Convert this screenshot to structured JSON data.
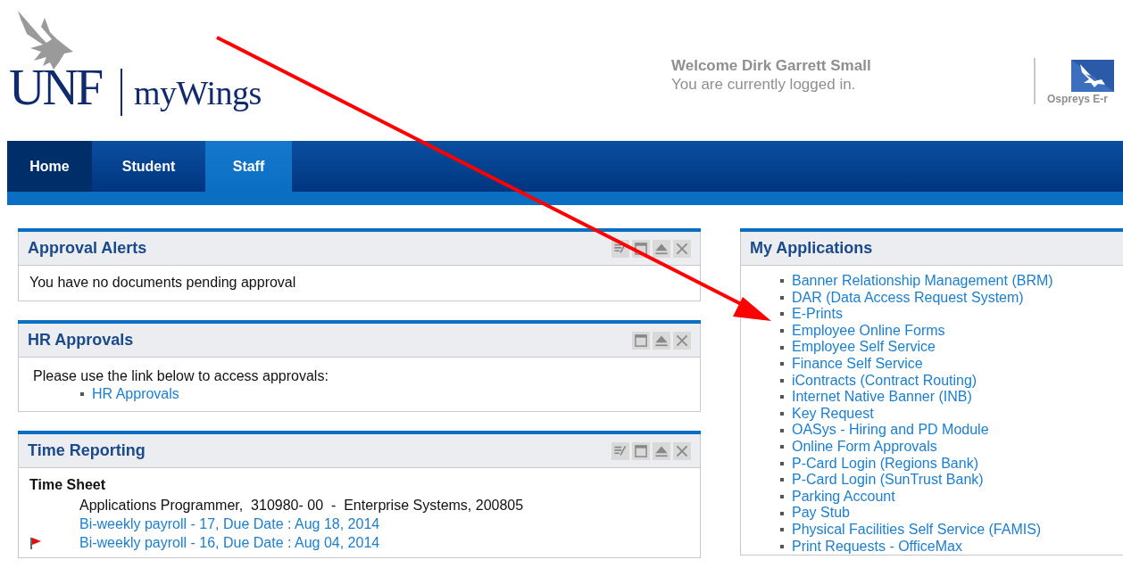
{
  "header": {
    "logo_mark": "UNF",
    "logo_name": "myWings",
    "welcome": "Welcome Dirk Garrett Small",
    "status": "You are currently logged in.",
    "quick_link": "Ospreys E-r"
  },
  "tabs": [
    {
      "label": "Home",
      "selected": false
    },
    {
      "label": "Student",
      "selected": false
    },
    {
      "label": "Staff",
      "selected": true
    }
  ],
  "left_portlets": [
    {
      "kind": "message",
      "title": "Approval Alerts",
      "editable": true,
      "message": "You have no documents pending approval"
    },
    {
      "kind": "links",
      "title": "HR Approvals",
      "editable": false,
      "intro": "Please use the link below to access approvals:",
      "links": [
        "HR Approvals"
      ]
    },
    {
      "kind": "timesheet",
      "title": "Time Reporting",
      "editable": true,
      "heading": "Time Sheet",
      "position": "Applications Programmer,  310980- 00  -  Enterprise Systems, 200805",
      "periods": [
        {
          "label": "Bi-weekly payroll - 17, Due Date : Aug 18, 2014",
          "flagged": false
        },
        {
          "label": "Bi-weekly payroll - 16, Due Date : Aug 04, 2014",
          "flagged": true
        }
      ]
    }
  ],
  "applications": {
    "title": "My Applications",
    "items": [
      "Banner Relationship Management (BRM)",
      "DAR (Data Access Request System)",
      "E-Prints",
      "Employee Online Forms",
      "Employee Self Service",
      "Finance Self Service",
      "iContracts (Contract Routing)",
      "Internet Native Banner (INB)",
      "Key Request",
      "OASys - Hiring and PD Module",
      "Online Form Approvals",
      "P-Card Login (Regions Bank)",
      "P-Card Login (SunTrust Bank)",
      "Parking Account",
      "Pay Stub",
      "Physical Facilities Self Service (FAMIS)",
      "Print Requests - OfficeMax"
    ]
  }
}
